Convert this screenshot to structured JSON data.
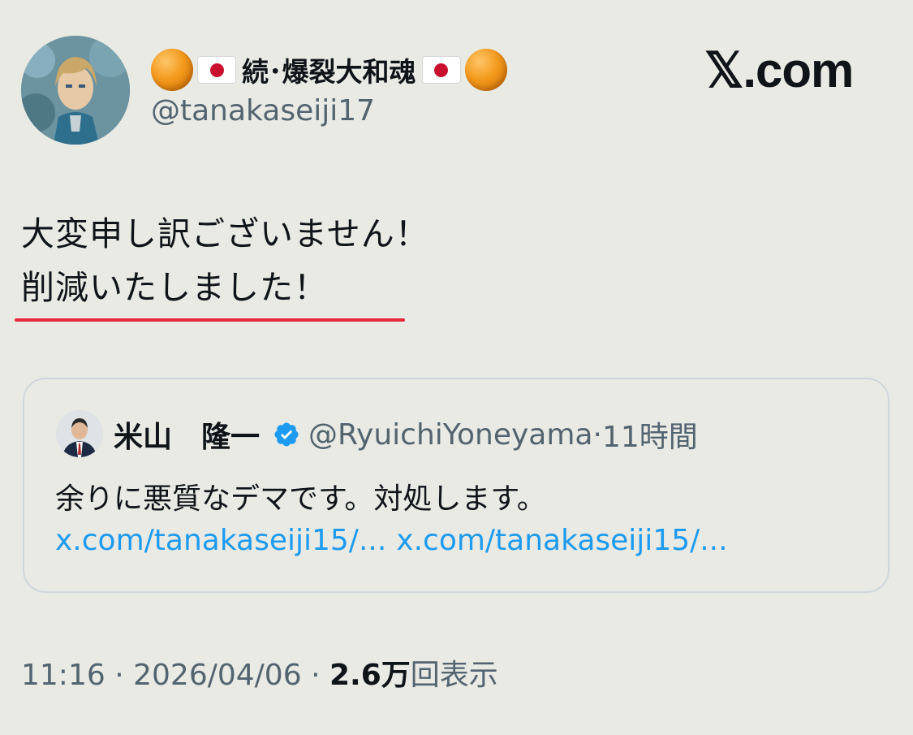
{
  "author": {
    "display_name": "続･爆裂大和魂",
    "handle": "@tanakaseiji17",
    "avatar_icon": "anime-character-avatar"
  },
  "brand": "𝕏.com",
  "tweet": {
    "line1": "大変申し訳ございません！",
    "line2": "削減いたしました！",
    "underline_color": "#e8263e"
  },
  "quote": {
    "name": "米山　隆一",
    "handle": "@RyuichiYoneyama",
    "separator": "·",
    "time": "11時間",
    "text": "余りに悪質なデマです。対処します。",
    "links": [
      "x.com/tanakaseiji15/...",
      "x.com/tanakaseiji15/..."
    ],
    "verified_color": "#1d9bf0"
  },
  "meta": {
    "time": "11:16",
    "sep1": "·",
    "date": "2026/04/06",
    "sep2": "·",
    "views_count": "2.6万",
    "views_label": "回表示"
  }
}
